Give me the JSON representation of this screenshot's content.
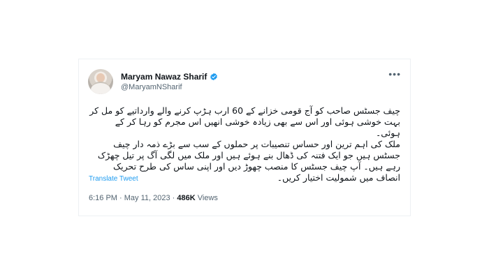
{
  "tweet": {
    "display_name": "Maryam Nawaz Sharif",
    "handle": "@MaryamNSharif",
    "verified_color": "#1d9bf0",
    "text": "چیف جسٹس صاحب کو آج قومی خزانے کے 60 ارب ہڑپ کرنے والے وارداتیے کو مل کر\nبہت خوشی ہوئی اور اس سے بھی زیادہ خوشی انھیں اس مجرم کو رہا کر کے ہوئی۔\nملک کی اہم ترین اور حساس تنصیبات پر حملوں کے سب سے بڑے ذمہ دار چیف\nجسٹس ہیں جو ایک فتنہ کی ڈھال بنے ہوئے ہیں اور ملک میں لگی آگ پر تیل چھڑک\nرہے ہیں۔ آپ چیف جسٹس کا منصب چھوڑ دیں اور اپنی ساس کی طرح تحریک\nانصاف میں شمولیت اختیار کریں۔",
    "translate_label": "Translate Tweet",
    "time": "6:16 PM",
    "separator": "·",
    "date": "May 11, 2023",
    "views_count": "486K",
    "views_label": "Views",
    "more_label": "•••"
  }
}
